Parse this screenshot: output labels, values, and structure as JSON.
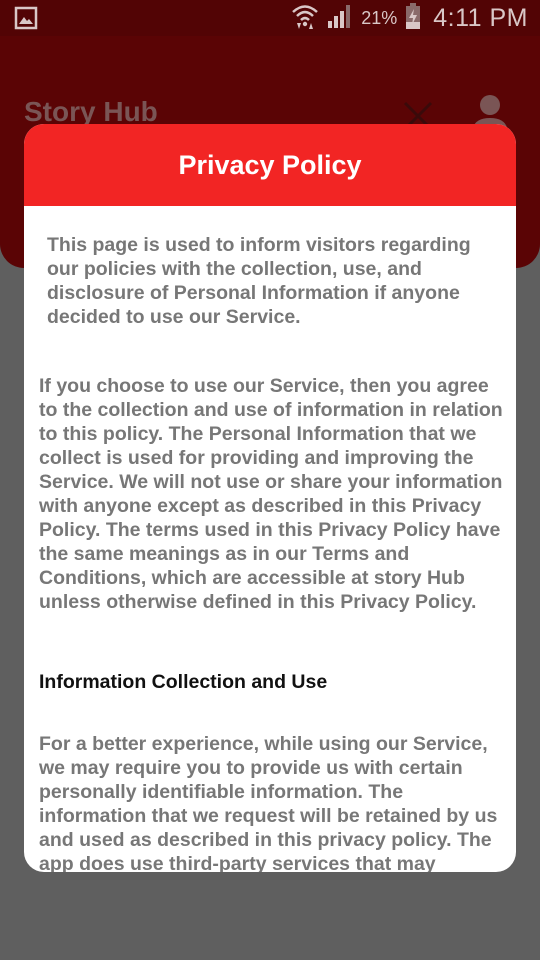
{
  "status_bar": {
    "battery_percent": "21%",
    "time": "4:11 PM",
    "icons": [
      "gallery-icon",
      "wifi-icon",
      "signal-icon",
      "battery-icon"
    ]
  },
  "app_bar": {
    "title": "Story Hub",
    "icons": [
      "close-icon",
      "user-icon"
    ]
  },
  "dialog": {
    "title": "Privacy Policy",
    "intro": "This page is used to inform visitors regarding our policies with the collection, use, and disclosure of Personal Information if anyone decided to use our Service.",
    "paragraph_1": "If you choose to use our Service, then you agree to the collection and use of information in relation to this policy. The Personal Information that we collect is used for providing and improving the Service. We will not use or share your information with anyone except as described in this Privacy Policy. The terms used in this Privacy Policy have the same meanings as in our Terms and Conditions, which are accessible at story Hub unless otherwise defined in this Privacy Policy.",
    "section_heading": "Information Collection and Use",
    "paragraph_2": "For a better experience, while using our Service, we may require you to provide us with certain personally identifiable information. The information that we request will be retained by us and used as described in this privacy policy. The app does use third-party services that may"
  },
  "colors": {
    "status_bar_bg": "#520405",
    "app_bar_bg_dimmed": "#5a0405",
    "dialog_header": "#f22524",
    "scrim": "#5f5f5f",
    "body_text": "#777777",
    "heading_text": "#111111"
  }
}
